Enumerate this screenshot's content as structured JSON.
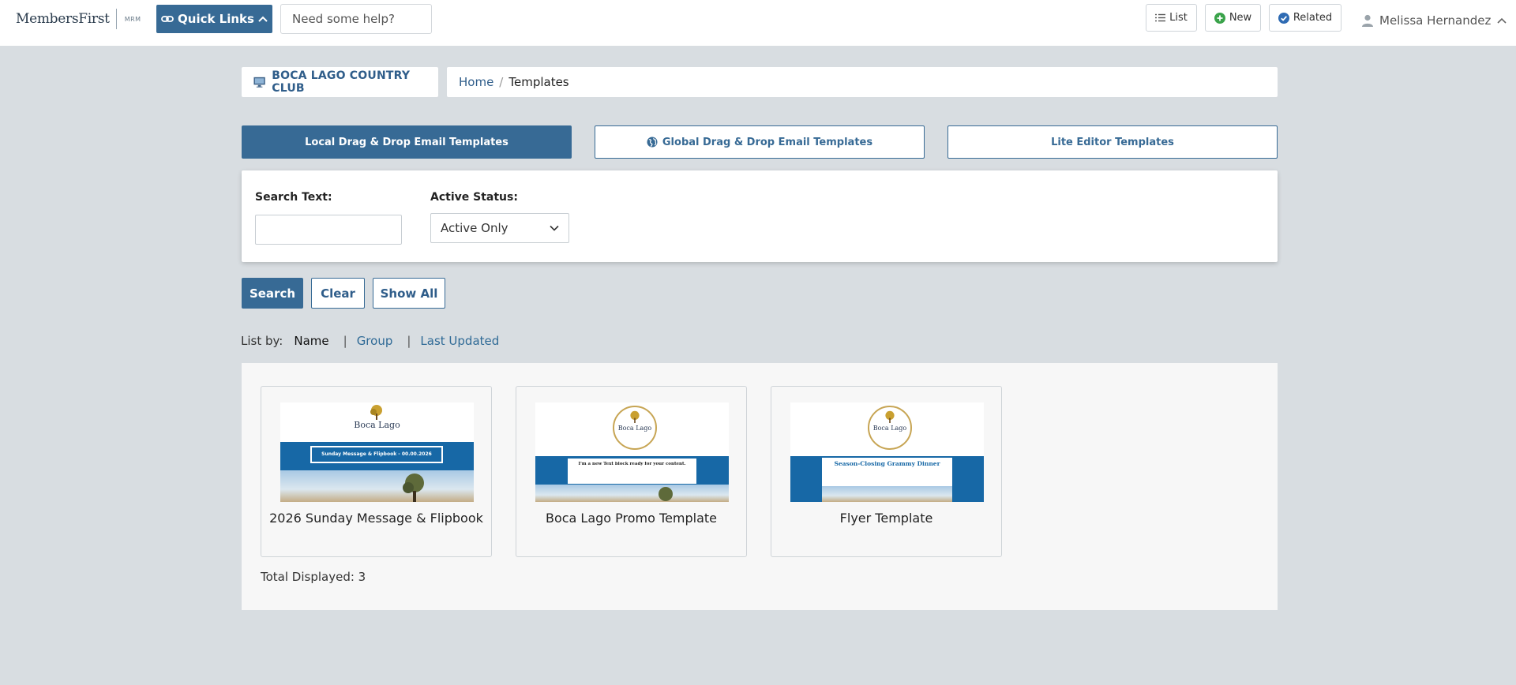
{
  "topbar": {
    "logo_text": "MembersFirst",
    "logo_sub": "MRM",
    "quick_links_label": "Quick Links",
    "help_placeholder": "Need some help?",
    "list_label": "List",
    "new_label": "New",
    "related_label": "Related",
    "user_name": "Melissa Hernandez"
  },
  "header": {
    "club_name": "BOCA LAGO COUNTRY CLUB",
    "breadcrumb_home": "Home",
    "breadcrumb_sep": "/",
    "breadcrumb_current": "Templates"
  },
  "tabs": [
    {
      "label": "Local Drag & Drop Email Templates",
      "active": true
    },
    {
      "label": "Global Drag & Drop Email Templates",
      "active": false
    },
    {
      "label": "Lite Editor Templates",
      "active": false
    }
  ],
  "filter": {
    "search_label": "Search Text:",
    "search_value": "",
    "status_label": "Active Status:",
    "status_value": "Active Only"
  },
  "actions": {
    "search": "Search",
    "clear": "Clear",
    "show_all": "Show All"
  },
  "list_by": {
    "label": "List by:",
    "options": [
      "Name",
      "Group",
      "Last Updated"
    ],
    "separator": "|"
  },
  "templates": [
    {
      "name": "2026 Sunday Message & Flipbook",
      "thumb_logo": "Boca Lago",
      "thumb_banner": "Sunday Message & Flipbook - 00.00.2026"
    },
    {
      "name": "Boca Lago Promo Template",
      "thumb_logo": "Boca Lago",
      "thumb_banner": "I'm a new Text block ready for your content."
    },
    {
      "name": "Flyer Template",
      "thumb_logo": "Boca Lago",
      "thumb_banner": "Season-Closing Grammy Dinner"
    }
  ],
  "total_displayed": "Total Displayed: 3",
  "colors": {
    "accent": "#376a95",
    "link": "#2f5d8a",
    "page_bg": "#d8dde1",
    "thumb_blue": "#1768a6"
  }
}
